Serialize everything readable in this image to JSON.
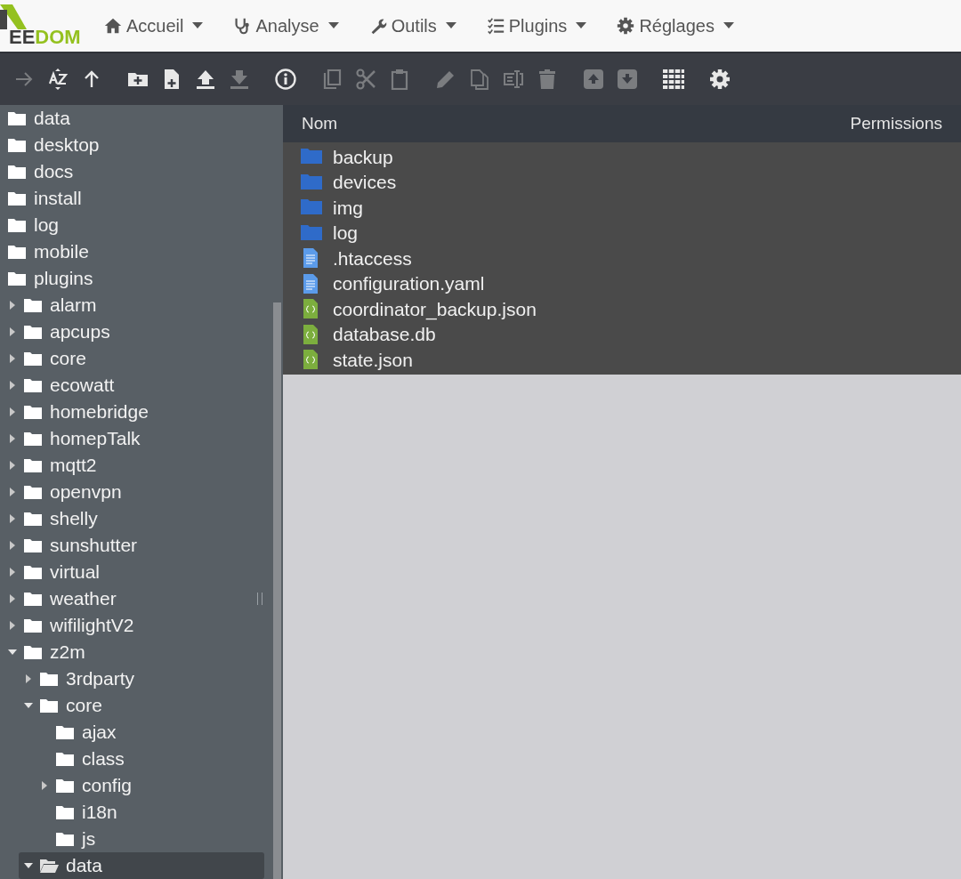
{
  "logo": {
    "part_1": "EE",
    "part_2": "DOM"
  },
  "menu": [
    {
      "label": "Accueil",
      "kind": "home"
    },
    {
      "label": "Analyse",
      "kind": "stethoscope"
    },
    {
      "label": "Outils",
      "kind": "wrench"
    },
    {
      "label": "Plugins",
      "kind": "list"
    },
    {
      "label": "Réglages",
      "kind": "gear"
    }
  ],
  "toolbar": [
    {
      "kind": "forward",
      "disabled": true
    },
    {
      "kind": "sort",
      "disabled": false
    },
    {
      "kind": "up",
      "disabled": false
    },
    {
      "kind": "new-folder",
      "disabled": false
    },
    {
      "kind": "new-file",
      "disabled": false
    },
    {
      "kind": "upload",
      "disabled": false
    },
    {
      "kind": "download",
      "disabled": true
    },
    {
      "kind": "info",
      "disabled": false
    },
    {
      "kind": "copy",
      "disabled": true
    },
    {
      "kind": "cut",
      "disabled": true
    },
    {
      "kind": "paste",
      "disabled": true
    },
    {
      "kind": "edit",
      "disabled": true
    },
    {
      "kind": "duplicate",
      "disabled": true
    },
    {
      "kind": "rename",
      "disabled": true
    },
    {
      "kind": "delete",
      "disabled": true
    },
    {
      "kind": "archive",
      "disabled": true
    },
    {
      "kind": "extract",
      "disabled": true
    },
    {
      "kind": "grid",
      "disabled": false
    },
    {
      "kind": "settings",
      "disabled": false
    }
  ],
  "tree": [
    {
      "label": "data",
      "selected": false
    },
    {
      "label": "desktop",
      "selected": false
    },
    {
      "label": "docs",
      "selected": false
    },
    {
      "label": "install",
      "selected": false
    },
    {
      "label": "log",
      "selected": false
    },
    {
      "label": "mobile",
      "selected": false
    },
    {
      "label": "plugins",
      "selected": false,
      "children": [
        {
          "label": "alarm",
          "selected": false,
          "expanded": false
        },
        {
          "label": "apcups",
          "selected": false,
          "expanded": false
        },
        {
          "label": "core",
          "selected": false,
          "expanded": false
        },
        {
          "label": "ecowatt",
          "selected": false,
          "expanded": false
        },
        {
          "label": "homebridge",
          "selected": false,
          "expanded": false
        },
        {
          "label": "homepTalk",
          "selected": false,
          "expanded": false
        },
        {
          "label": "mqtt2",
          "selected": false,
          "expanded": false
        },
        {
          "label": "openvpn",
          "selected": false,
          "expanded": false
        },
        {
          "label": "shelly",
          "selected": false,
          "expanded": false
        },
        {
          "label": "sunshutter",
          "selected": false,
          "expanded": false
        },
        {
          "label": "virtual",
          "selected": false,
          "expanded": false
        },
        {
          "label": "weather",
          "selected": false,
          "expanded": false
        },
        {
          "label": "wifilightV2",
          "selected": false,
          "expanded": false
        },
        {
          "label": "z2m",
          "selected": false,
          "expanded": true,
          "children": [
            {
              "label": "3rdparty",
              "selected": false,
              "expanded": false
            },
            {
              "label": "core",
              "selected": false,
              "expanded": true,
              "children": [
                {
                  "label": "ajax",
                  "selected": false
                },
                {
                  "label": "class",
                  "selected": false
                },
                {
                  "label": "config",
                  "selected": false,
                  "expanded": false
                },
                {
                  "label": "i18n",
                  "selected": false
                },
                {
                  "label": "js",
                  "selected": false
                }
              ]
            },
            {
              "label": "data",
              "selected": true,
              "expanded": true
            }
          ]
        }
      ]
    }
  ],
  "table": {
    "columns": [
      "Nom",
      "Permissions"
    ],
    "rows": [
      {
        "name": "backup",
        "kind": "folder"
      },
      {
        "name": "devices",
        "kind": "folder"
      },
      {
        "name": "img",
        "kind": "folder"
      },
      {
        "name": "log",
        "kind": "folder"
      },
      {
        "name": ".htaccess",
        "kind": "text"
      },
      {
        "name": "configuration.yaml",
        "kind": "text"
      },
      {
        "name": "coordinator_backup.json",
        "kind": "json"
      },
      {
        "name": "database.db",
        "kind": "json"
      },
      {
        "name": "state.json",
        "kind": "json"
      }
    ]
  }
}
